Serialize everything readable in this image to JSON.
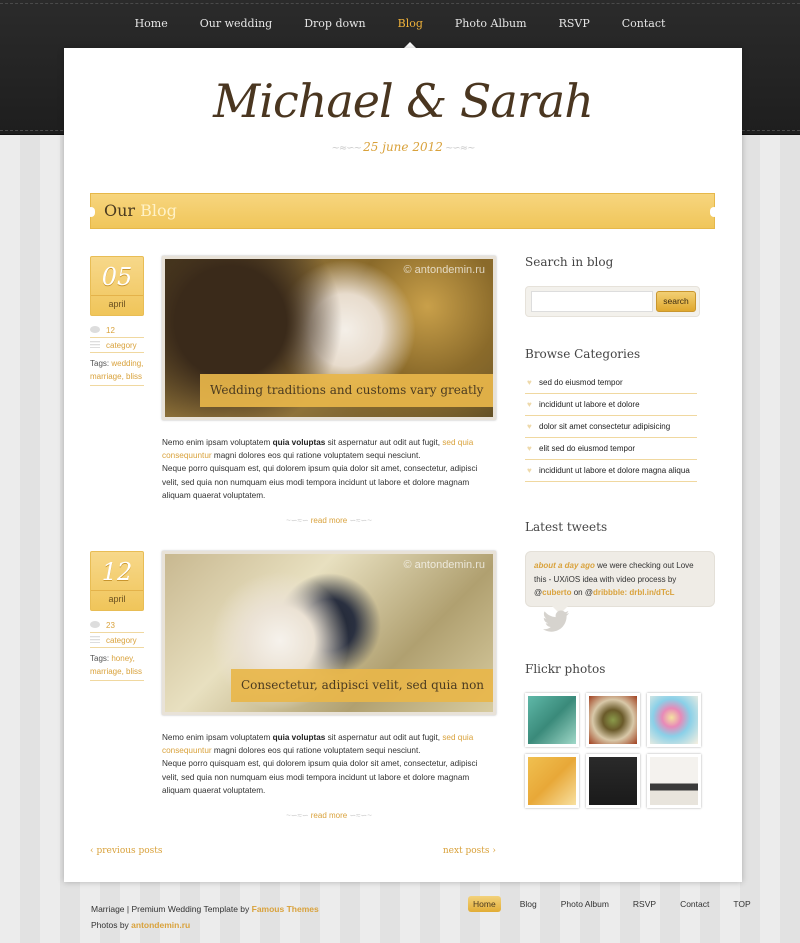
{
  "nav": {
    "items": [
      "Home",
      "Our wedding",
      "Drop down",
      "Blog",
      "Photo Album",
      "RSVP",
      "Contact"
    ],
    "active": "Blog"
  },
  "header": {
    "title": "Michael & Sarah",
    "date": "25 june 2012"
  },
  "banner": {
    "prefix": "Our",
    "highlight": "Blog"
  },
  "posts": [
    {
      "day": "05",
      "month": "april",
      "comments": "12",
      "category": "category",
      "tags_label": "Tags:",
      "tags": [
        "wedding,",
        "marriage,",
        "bliss"
      ],
      "caption": "Wedding traditions and customs vary greatly",
      "watermark": "© antondemin.ru",
      "p1a": "Nemo enim ipsam voluptatem ",
      "p1b": "quia voluptas",
      "p1c": " sit aspernatur aut odit aut fugit, ",
      "p1link": "sed quia consequuntur",
      "p1d": " magni dolores eos qui ratione voluptatem sequi nesciunt.",
      "p2": "Neque porro quisquam est, qui dolorem ipsum quia dolor sit amet, consectetur, adipisci velit, sed quia non numquam eius modi tempora incidunt ut labore et dolore magnam aliquam quaerat voluptatem.",
      "readmore": "read more"
    },
    {
      "day": "12",
      "month": "april",
      "comments": "23",
      "category": "category",
      "tags_label": "Tags:",
      "tags": [
        "honey,",
        "marriage,",
        "bliss"
      ],
      "caption": "Consectetur, adipisci velit, sed quia non",
      "watermark": "© antondemin.ru",
      "p1a": "Nemo enim ipsam voluptatem ",
      "p1b": "quia voluptas",
      "p1c": " sit aspernatur aut odit aut fugit, ",
      "p1link": "sed quia consequuntur",
      "p1d": " magni dolores eos qui ratione voluptatem sequi nesciunt.",
      "p2": "Neque porro quisquam est, qui dolorem ipsum quia dolor sit amet, consectetur, adipisci velit, sed quia non numquam eius modi tempora incidunt ut labore et dolore magnam aliquam quaerat voluptatem.",
      "readmore": "read more"
    }
  ],
  "pager": {
    "prev": "‹ previous posts",
    "next": "next posts ›"
  },
  "sidebar": {
    "search_title": "Search in blog",
    "search_button": "search",
    "search_value": "",
    "categories_title": "Browse Categories",
    "categories": [
      "sed do eiusmod tempor",
      "incididunt ut labore et dolore",
      "dolor sit amet consectetur adipisicing",
      "elit sed do eiusmod tempor",
      "incididunt ut labore et dolore magna aliqua"
    ],
    "tweets_title": "Latest tweets",
    "tweet": {
      "time": "about a day ago",
      "text": " we were checking out Love this - UX/iOS idea with video process by ",
      "user1": "cuberto",
      "on": " on ",
      "user2": "dribbble:",
      "link": "drbl.in/dTcL"
    },
    "flickr_title": "Flickr photos",
    "flickr_colors": [
      "#5fb8a8",
      "#8a9a4a",
      "#e8d08a",
      "#e8a838",
      "#222222",
      "#d8d4cc"
    ]
  },
  "footer": {
    "line1": "Marriage | Premium Wedding Template by ",
    "line1_link": "Famous Themes",
    "line2": "Photos by ",
    "line2_link": "antondemin.ru",
    "nav": [
      "Home",
      "Blog",
      "Photo Album",
      "RSVP",
      "Contact",
      "TOP"
    ],
    "active": "Home"
  },
  "colors": {
    "accent": "#d9a23c",
    "banner": "#f0c65a",
    "dark": "#222222"
  }
}
